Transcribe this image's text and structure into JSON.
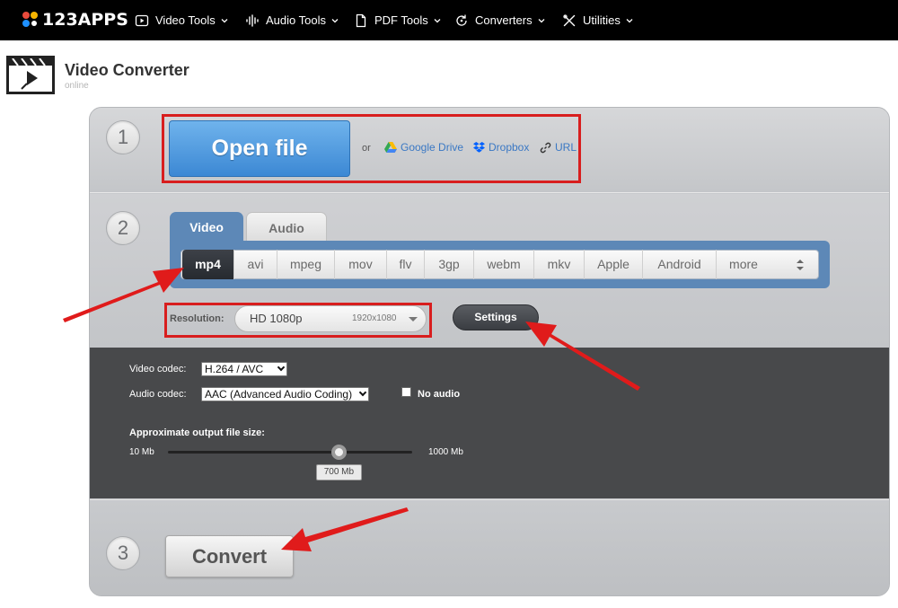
{
  "nav": {
    "logo_text": "123APPS",
    "items": [
      {
        "label": "Video Tools"
      },
      {
        "label": "Audio Tools"
      },
      {
        "label": "PDF Tools"
      },
      {
        "label": "Converters"
      },
      {
        "label": "Utilities"
      }
    ]
  },
  "header": {
    "title": "Video Converter",
    "subtitle": "online"
  },
  "step1": {
    "number": "1",
    "open_label": "Open file",
    "or_label": "or",
    "sources": [
      {
        "label": "Google Drive",
        "icon": "google-drive-icon"
      },
      {
        "label": "Dropbox",
        "icon": "dropbox-icon"
      },
      {
        "label": "URL",
        "icon": "link-icon"
      }
    ]
  },
  "step2": {
    "number": "2",
    "tabs": [
      {
        "label": "Video",
        "active": true
      },
      {
        "label": "Audio",
        "active": false
      }
    ],
    "formats": [
      "mp4",
      "avi",
      "mpeg",
      "mov",
      "flv",
      "3gp",
      "webm",
      "mkv",
      "Apple",
      "Android",
      "more"
    ],
    "selected_format": "mp4",
    "resolution_label": "Resolution:",
    "resolution_value": "HD 1080p",
    "resolution_dims": "1920x1080",
    "settings_label": "Settings"
  },
  "settings": {
    "video_codec_label": "Video codec:",
    "video_codec_value": "H.264 / AVC",
    "audio_codec_label": "Audio codec:",
    "audio_codec_value": "AAC (Advanced Audio Coding)",
    "no_audio_label": "No audio",
    "no_audio_checked": false,
    "filesize_label": "Approximate output file size:",
    "filesize_min": "10 Mb",
    "filesize_max": "1000 Mb",
    "filesize_value": "700 Mb",
    "filesize_fraction": 0.7
  },
  "step3": {
    "number": "3",
    "convert_label": "Convert"
  },
  "colors": {
    "accent_blue": "#5d88b7",
    "open_button": "#4a95dd",
    "highlight_red": "#d81e1e",
    "nav_bg": "#000000"
  }
}
